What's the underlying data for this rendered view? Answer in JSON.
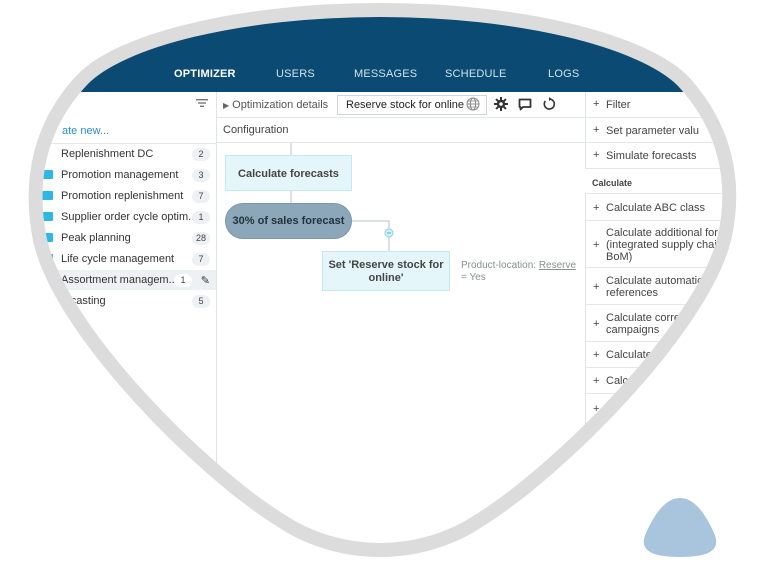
{
  "nav": {
    "tabs": [
      {
        "label": "OPTIMIZER",
        "active": true
      },
      {
        "label": "USERS"
      },
      {
        "label": "MESSAGES"
      },
      {
        "label": "SCHEDULE"
      },
      {
        "label": "LOGS"
      }
    ]
  },
  "left": {
    "create_new": "ate new...",
    "items": [
      {
        "label": "Replenishment DC",
        "count": "2",
        "icon": "none"
      },
      {
        "label": "Promotion management",
        "count": "3",
        "icon": "folder-icon"
      },
      {
        "label": "Promotion replenishment",
        "count": "7",
        "icon": "folder-icon"
      },
      {
        "label": "Supplier order cycle optim...",
        "count": "1",
        "icon": "folder-icon"
      },
      {
        "label": "Peak planning",
        "count": "28",
        "icon": "folder-icon"
      },
      {
        "label": "Life cycle management",
        "count": "7",
        "icon": "folder-icon"
      },
      {
        "label": "Assortment managem...",
        "count": "1",
        "icon": "none",
        "selected": true
      },
      {
        "label": "recasting",
        "count": "5",
        "icon": "none"
      }
    ]
  },
  "toolbar": {
    "details_label": "Optimization details",
    "selected_value": "Reserve stock for online"
  },
  "config": {
    "label": "Configuration"
  },
  "canvas": {
    "node_calc": "Calculate forecasts",
    "node_pill": "30% of sales forecast",
    "node_set_line1": "Set 'Reserve stock for",
    "node_set_line2": "online'",
    "condition_prefix": "Product-location: ",
    "condition_link": "Reserve",
    "condition_suffix": "= Yes"
  },
  "right": {
    "rows": [
      {
        "label": "Filter"
      },
      {
        "label": "Set parameter valu"
      },
      {
        "label": "Simulate forecasts"
      }
    ],
    "section": "Calculate",
    "calc_rows": [
      {
        "lines": [
          "Calculate ABC class"
        ]
      },
      {
        "lines": [
          "Calculate additional forec",
          "(integrated supply chain",
          "BoM)"
        ]
      },
      {
        "lines": [
          "Calculate automatic",
          "references"
        ]
      },
      {
        "lines": [
          "Calculate correct",
          "campaigns"
        ]
      },
      {
        "lines": [
          "Calculate c"
        ]
      },
      {
        "lines": [
          "Calcu"
        ]
      },
      {
        "lines": [
          "C"
        ]
      }
    ]
  },
  "colors": {
    "topbar": "#0b4a72",
    "accent": "#2eb6e6",
    "node_bg": "#e5f6fb",
    "pill_bg": "#8ba7b9",
    "frame": "#dcdcdc",
    "bottom_blob": "#a9c4dd"
  }
}
